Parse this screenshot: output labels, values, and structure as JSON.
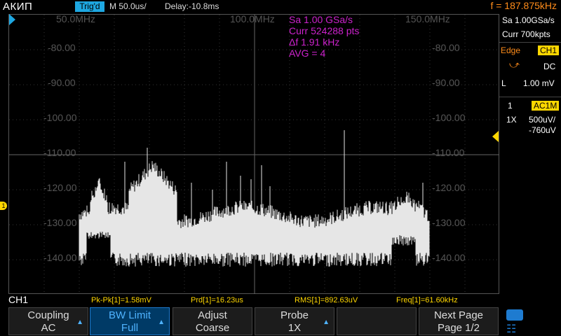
{
  "topbar": {
    "brand": "АКИП",
    "trigger_status": "Trig'd",
    "timebase": "M 50.0us/",
    "delay": "Delay:-10.8ms",
    "frequency": "f = 187.875kHz"
  },
  "fft_info": {
    "sample_rate": "Sa 1.00 GSa/s",
    "curr_points": "Curr 524288 pts",
    "delta_f": "Δf 1.91 kHz",
    "avg": "AVG = 4",
    "color": "#cc22cc"
  },
  "x_labels": [
    "50.0MHz",
    "100.0MHz",
    "150.0MHz"
  ],
  "y_labels": [
    "-80.00",
    "-90.00",
    "-100.00",
    "-110.00",
    "-120.00",
    "-130.00",
    "-140.00"
  ],
  "right_panel": {
    "sample_rate": "Sa 1.00GSa/s",
    "curr": "Curr 700kpts",
    "trigger_type": "Edge",
    "trigger_source": "CH1",
    "coupling": "DC",
    "level_label": "L",
    "level_value": "1.00 mV",
    "channel_num": "1",
    "channel_coupling": "AC1M",
    "probe": "1X",
    "volts_div": "500uV/",
    "offset": "-760uV"
  },
  "measurements": {
    "channel": "CH1",
    "pkpk": "Pk-Pk[1]=1.58mV",
    "prd": "Prd[1]=16.23us",
    "rms": "RMS[1]=892.63uV",
    "freq": "Freq[1]=61.60kHz"
  },
  "softkeys": [
    {
      "line1": "Coupling",
      "line2": "AC",
      "arrow": true,
      "active": false
    },
    {
      "line1": "BW Limit",
      "line2": "Full",
      "arrow": true,
      "active": true
    },
    {
      "line1": "Adjust",
      "line2": "Coarse",
      "arrow": false,
      "active": false
    },
    {
      "line1": "Probe",
      "line2": "1X",
      "arrow": true,
      "active": false
    },
    {
      "line1": "",
      "line2": "",
      "arrow": false,
      "active": false
    },
    {
      "line1": "Next Page",
      "line2": "Page 1/2",
      "arrow": false,
      "active": false
    }
  ],
  "markers": {
    "ch1": "1"
  },
  "colors": {
    "accent_blue": "#1ea7e1",
    "channel_yellow": "#ffd700",
    "freq_orange": "#ff8c1a",
    "trace": "#e6e6e6"
  }
}
